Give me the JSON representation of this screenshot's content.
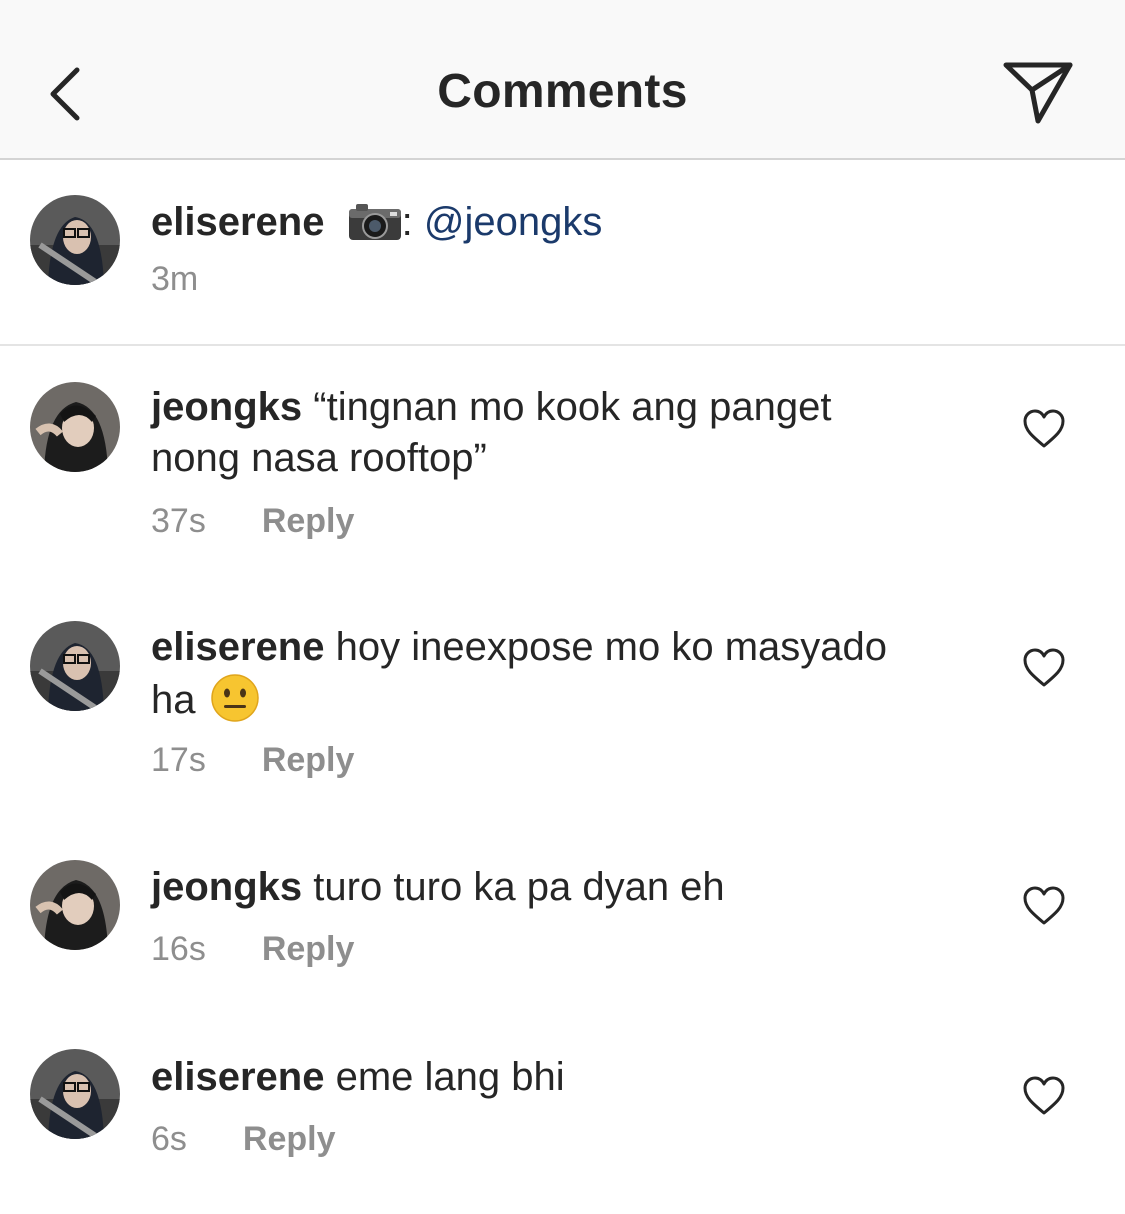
{
  "header": {
    "title": "Comments"
  },
  "caption": {
    "username": "eliserene",
    "separator": ":",
    "mention": "@jeongks",
    "time": "3m"
  },
  "comments": [
    {
      "username": "jeongks",
      "text": "“tingnan mo kook ang panget nong nasa rooftop”",
      "time": "37s",
      "reply_label": "Reply"
    },
    {
      "username": "eliserene",
      "text": "hoy ineexpose mo ko masyado ha",
      "time": "17s",
      "reply_label": "Reply"
    },
    {
      "username": "jeongks",
      "text": "turo turo ka pa dyan eh",
      "time": "16s",
      "reply_label": "Reply"
    },
    {
      "username": "eliserene",
      "text": "eme lang bhi",
      "time": "6s",
      "reply_label": "Reply"
    }
  ],
  "icons": {
    "back": "chevron-left-icon",
    "send": "paper-plane-icon",
    "like": "heart-icon",
    "camera": "camera-emoji",
    "neutral_face": "neutral-face-emoji"
  },
  "colors": {
    "header_bg": "#f9f9f9",
    "text": "#262626",
    "secondary_text": "#8e8e8e",
    "mention": "#1b3a6b"
  }
}
